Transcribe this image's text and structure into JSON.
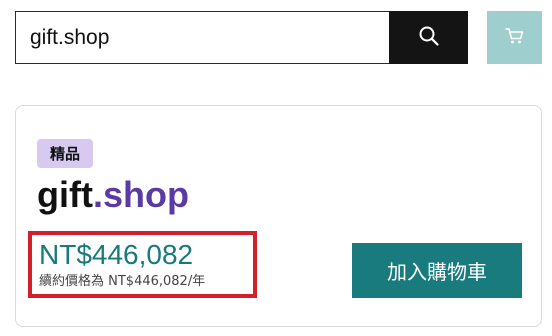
{
  "search": {
    "value": "gift.shop",
    "button_icon": "search-icon"
  },
  "header": {
    "cart_icon": "cart-icon",
    "cart_color": "#9ecece"
  },
  "result": {
    "badge": "精品",
    "domain": {
      "sld": "gift",
      "tld": ".shop"
    },
    "price": "NT$446,082",
    "renewal": "續約價格為 NT$446,082/年",
    "add_to_cart_label": "加入購物車"
  },
  "colors": {
    "accent": "#197b7d",
    "tld": "#5b3aa5",
    "badge": "#d8c9f1",
    "highlight_border": "#d4202a"
  }
}
